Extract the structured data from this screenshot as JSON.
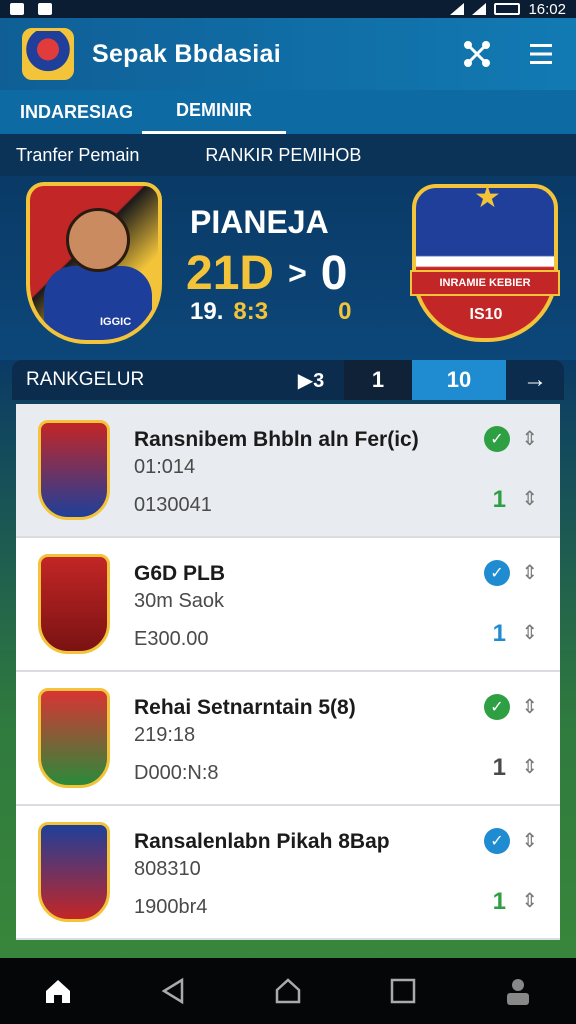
{
  "status_bar": {
    "time": "16:02"
  },
  "app": {
    "title": "Sepak Bbdasiai"
  },
  "tabs": [
    {
      "label": "INDARESIAG"
    },
    {
      "label": "DEMINIR"
    }
  ],
  "sub_bar": {
    "left": "Tranfer Pemain",
    "right": "RANKIR PEMIHOB"
  },
  "hero": {
    "title": "PIANEJA",
    "score_left": "21D",
    "score_arrow": ">",
    "score_right": "0",
    "sub_left": "19.",
    "sub_mid": "8:3",
    "sub_right": "0",
    "player_label": "IGGIC",
    "crest_banner": "INRAMIE KEBIER",
    "crest_year": "IS10"
  },
  "ranking": {
    "label": "RANKGELUR",
    "prev": "▶3",
    "page": "1",
    "current": "10",
    "next": "→"
  },
  "list": [
    {
      "name": "Ransnibem Bhbln aln Fer(ic)",
      "meta1": "01:014",
      "meta2": "0130041",
      "rank": "1",
      "check_color": "#2ea043",
      "rank_color": "#2ea043"
    },
    {
      "name": "G6D PLB",
      "meta1": "30m Saok",
      "meta2": "E300.00",
      "rank": "1",
      "check_color": "#1f8bd0",
      "rank_color": "#1f8bd0"
    },
    {
      "name": "Rehai Setnarntain 5(8)",
      "meta1": "219:18",
      "meta2": "D000:N:8",
      "rank": "1",
      "check_color": "#2ea043",
      "rank_color": "#4a4a4a"
    },
    {
      "name": "Ransalenlabn Pikah 8Bap",
      "meta1": "808310",
      "meta2": "1900br4",
      "rank": "1",
      "check_color": "#1f8bd0",
      "rank_color": "#2ea043"
    }
  ],
  "bottom_nav": [
    "home-icon",
    "back-icon",
    "circle-home-icon",
    "recents-icon",
    "profile-icon"
  ]
}
